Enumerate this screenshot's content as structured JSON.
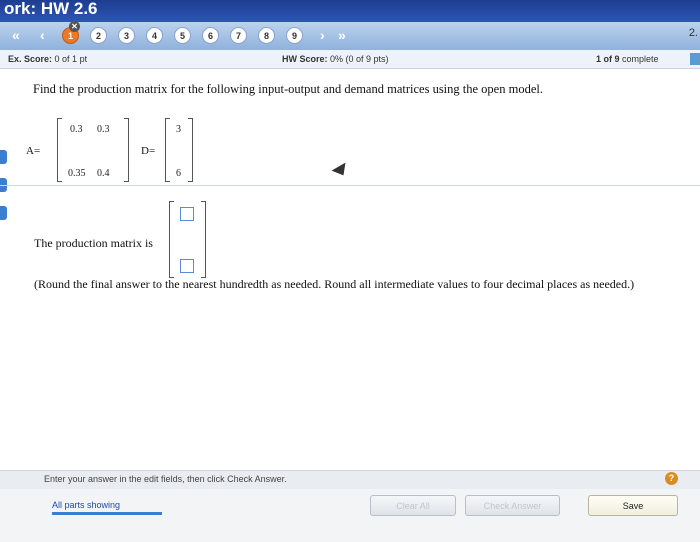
{
  "window": {
    "title": "ork:  HW 2.6"
  },
  "nav": {
    "first_arrows": "«",
    "prev_arrow": "‹",
    "next_arrow": "›",
    "last_arrows": "»",
    "questions": [
      {
        "num": "1",
        "badge": "✕",
        "state": "current"
      },
      {
        "num": "2",
        "badge": "",
        "state": "normal"
      },
      {
        "num": "3",
        "badge": "",
        "state": "normal"
      },
      {
        "num": "4",
        "badge": "",
        "state": "normal"
      },
      {
        "num": "5",
        "badge": "",
        "state": "normal"
      },
      {
        "num": "6",
        "badge": "",
        "state": "normal"
      },
      {
        "num": "7",
        "badge": "",
        "state": "normal"
      },
      {
        "num": "8",
        "badge": "",
        "state": "normal"
      },
      {
        "num": "9",
        "badge": "",
        "state": "normal"
      }
    ],
    "right_text": "2."
  },
  "score": {
    "ex_label": "Ex. Score:",
    "ex_value": "0 of 1 pt",
    "hw_label": "HW Score:",
    "hw_value": "0% (0 of 9 pts)",
    "progress_num": "1 of 9",
    "progress_word": "complete"
  },
  "question": {
    "prompt": "Find the production matrix for the following input-output and demand matrices using the open model.",
    "matrix_a_label": "A=",
    "matrix_a": [
      [
        "0.3",
        "0.3"
      ],
      [
        "0.35",
        "0.4"
      ]
    ],
    "matrix_d_label": "D=",
    "matrix_d": [
      "3",
      "6"
    ],
    "production_label": "The production matrix is",
    "instructions": "(Round the final answer to the nearest hundredth as needed. Round all intermediate values to four decimal places as needed.)"
  },
  "footer": {
    "instruction": "Enter your answer in the edit fields, then click Check Answer.",
    "all_parts": "All parts showing",
    "clear_all": "Clear All",
    "check_answer": "Check Answer",
    "save": "Save",
    "help": "?"
  },
  "colors": {
    "accent_blue": "#3a7fcf",
    "current_question": "#e87a2a"
  }
}
